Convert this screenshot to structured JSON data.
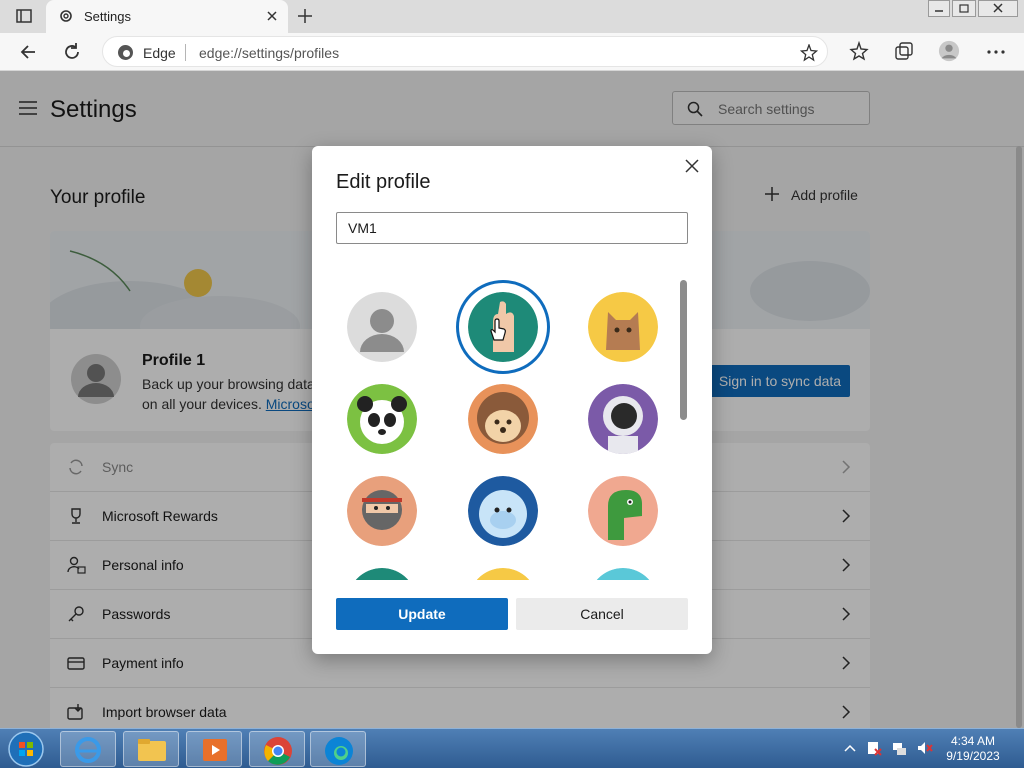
{
  "browser": {
    "tab_title": "Settings",
    "address_label": "Edge",
    "url": "edge://settings/profiles"
  },
  "settings": {
    "title": "Settings",
    "search_placeholder": "Search settings",
    "your_profile": "Your profile",
    "add_profile": "Add profile",
    "profile_name": "Profile 1",
    "profile_desc": "Back up your browsing data",
    "profile_desc2": "on all your devices.",
    "profile_link": "Microso",
    "sync_button": "Sign in to sync data",
    "menu": [
      {
        "label": "Sync",
        "icon": "sync-icon",
        "disabled": true
      },
      {
        "label": "Microsoft Rewards",
        "icon": "trophy-icon",
        "disabled": false
      },
      {
        "label": "Personal info",
        "icon": "person-info-icon",
        "disabled": false
      },
      {
        "label": "Passwords",
        "icon": "key-icon",
        "disabled": false
      },
      {
        "label": "Payment info",
        "icon": "card-icon",
        "disabled": false
      },
      {
        "label": "Import browser data",
        "icon": "import-icon",
        "disabled": false
      }
    ]
  },
  "dialog": {
    "title": "Edit profile",
    "name_value": "VM1",
    "avatars": [
      "default-person",
      "hand",
      "cat",
      "panda",
      "hedgehog",
      "astronaut",
      "ninja",
      "yeti",
      "dinosaur"
    ],
    "selected_avatar": "hand",
    "update_button": "Update",
    "cancel_button": "Cancel"
  },
  "taskbar": {
    "time": "4:34 AM",
    "date": "9/19/2023"
  }
}
